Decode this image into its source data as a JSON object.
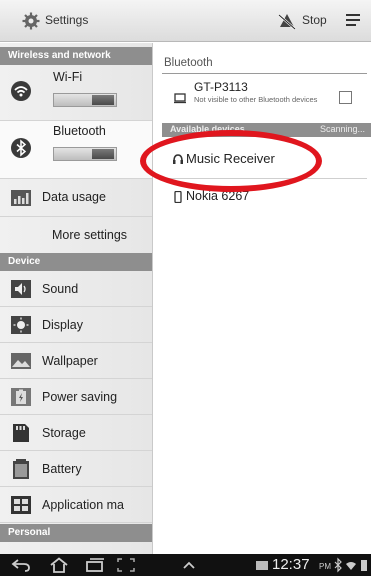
{
  "actionbar": {
    "title": "Settings",
    "stop_label": "Stop"
  },
  "sidebar": {
    "sections": [
      {
        "label": "Wireless and network"
      },
      {
        "label": "Device"
      },
      {
        "label": "Personal"
      }
    ],
    "items": [
      {
        "label": "Wi-Fi",
        "icon": "wifi-icon",
        "toggle": "on"
      },
      {
        "label": "Bluetooth",
        "icon": "bluetooth-icon",
        "toggle": "on",
        "selected": true
      },
      {
        "label": "Data usage",
        "icon": "data-usage-icon"
      },
      {
        "label": "More settings"
      },
      {
        "label": "Sound",
        "icon": "speaker-icon"
      },
      {
        "label": "Display",
        "icon": "display-icon"
      },
      {
        "label": "Wallpaper",
        "icon": "wallpaper-icon"
      },
      {
        "label": "Power saving",
        "icon": "power-saving-icon"
      },
      {
        "label": "Storage",
        "icon": "storage-icon"
      },
      {
        "label": "Battery",
        "icon": "battery-icon"
      },
      {
        "label": "Application ma",
        "icon": "application-manager-icon"
      }
    ]
  },
  "bluetooth": {
    "title": "Bluetooth",
    "my_device": {
      "name": "GT-P3113",
      "status": "Not visible to other Bluetooth devices",
      "visible_checked": false
    },
    "available_header": "Available devices",
    "scanning_label": "Scanning...",
    "devices": [
      {
        "name": "Music Receiver",
        "icon": "headphones-icon"
      },
      {
        "name": "Nokia 6267",
        "icon": "phone-icon"
      }
    ]
  },
  "systembar": {
    "time": "12:37",
    "ampm": "PM"
  },
  "colors": {
    "highlight_ellipse": "#e0161e",
    "section_header": "#8e8e8e"
  }
}
